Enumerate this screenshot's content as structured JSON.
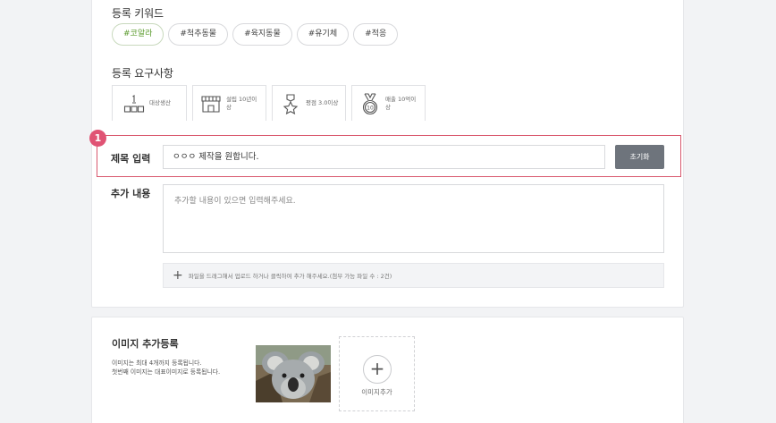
{
  "keywords": {
    "title": "등록 키워드",
    "chips": [
      "#코알라",
      "#척추동물",
      "#육지동물",
      "#유기체",
      "#적응"
    ]
  },
  "requirements": {
    "title": "등록 요구사항",
    "items": [
      {
        "label": "대상생산",
        "icon": "podium-icon"
      },
      {
        "label": "설립 10년이상",
        "icon": "store-icon"
      },
      {
        "label": "평점 3.0이상",
        "icon": "award-star-icon"
      },
      {
        "label": "매출 10억이상",
        "icon": "medal-10-icon"
      }
    ]
  },
  "step_badge": "1",
  "title_row": {
    "label": "제목 입력",
    "value": "ㅇㅇㅇ 제작을 원합니다.",
    "reset_label": "초기화"
  },
  "content_row": {
    "label": "추가 내용",
    "placeholder": "추가할 내용이 있으면 입력해주세요."
  },
  "dropzone": {
    "plus": "+",
    "text": "파일을 드래그해서 업로드 하거나 클릭하여 추가 해주세요.(첨부 가능 파일 수 : 2건)"
  },
  "image_section": {
    "title": "이미지 추가등록",
    "desc_line1": "이미지는 최대 4개까지 등록됩니다.",
    "desc_line2": "첫번째 이미지는 대표이미지로 등록됩니다.",
    "add_plus": "+",
    "add_label": "이미지추가"
  },
  "colors": {
    "accent_green": "#5a9a2c",
    "highlight": "#d9586e",
    "badge": "#e05374",
    "button": "#6e747c"
  }
}
